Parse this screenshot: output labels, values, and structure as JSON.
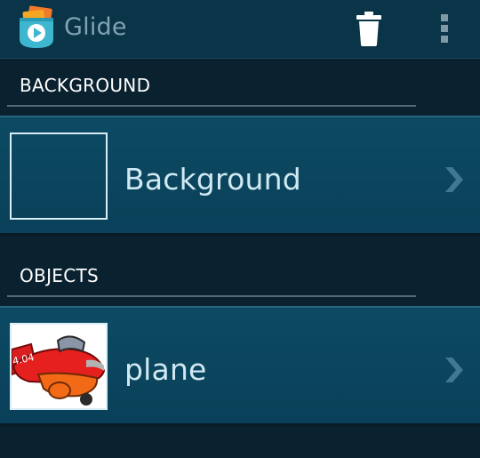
{
  "actionbar": {
    "title": "Glide",
    "app_icon": "glide-app-icon",
    "actions": [
      {
        "icon": "trash-icon"
      },
      {
        "icon": "overflow-menu-icon"
      }
    ]
  },
  "sections": {
    "background": {
      "label": "BACKGROUND",
      "items": [
        {
          "label": "Background",
          "thumbnail": "empty-thumbnail"
        }
      ]
    },
    "objects": {
      "label": "OBJECTS",
      "items": [
        {
          "label": "plane",
          "thumbnail": "plane-thumbnail",
          "thumbnail_text": "4.04"
        }
      ]
    }
  },
  "colors": {
    "actionbar_bg": "#0a3447",
    "list_item_bg": "#0c4a63",
    "window_bg": "#0a2230",
    "title_text": "#7fa3b3",
    "item_text": "#cfe9f2"
  }
}
